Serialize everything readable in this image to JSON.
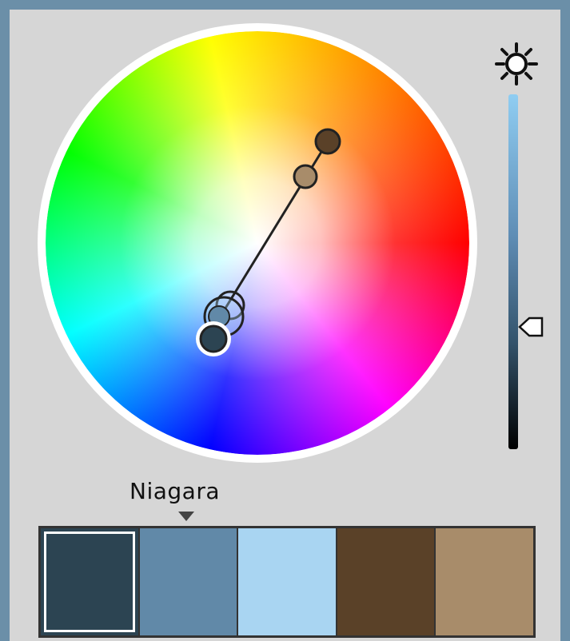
{
  "scheme": {
    "name": "Niagara"
  },
  "colors": {
    "accent_line": "#222222",
    "slider_top": "#8fcdf2",
    "slider_bottom": "#000000"
  },
  "icons": {
    "brightness": "sun-icon",
    "slider_handle": "triangle-handle-icon",
    "scheme_dropdown": "chevron-down-icon"
  },
  "brightness_level": 0.65,
  "swatches": [
    {
      "color": "#2c4452",
      "selected": true
    },
    {
      "color": "#6189a8",
      "selected": false
    },
    {
      "color": "#a9d5f2",
      "selected": false
    },
    {
      "color": "#5a4128",
      "selected": false
    },
    {
      "color": "#a88c6a",
      "selected": false
    }
  ]
}
